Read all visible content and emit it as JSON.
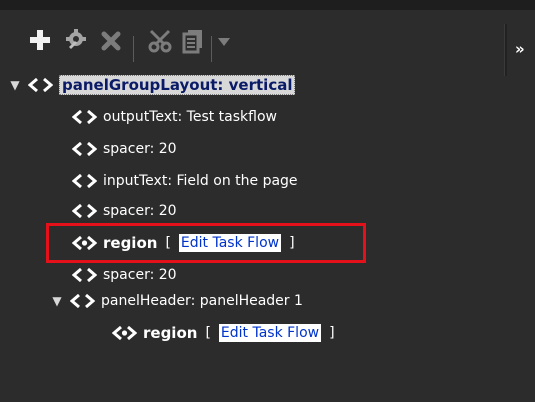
{
  "toolbar": {
    "items": [
      {
        "icon": "plus-icon",
        "color": "#f2f2f2"
      },
      {
        "icon": "gear-icon",
        "color": "#a4a4a4"
      },
      {
        "icon": "delete-icon",
        "color": "#7c7c7c"
      },
      {
        "icon": "cut-icon",
        "color": "#7c7c7c"
      },
      {
        "icon": "copy-icon",
        "color": "#7c7c7c"
      },
      {
        "icon": "dropdown-arrow-icon",
        "color": "#7c7c7c"
      }
    ],
    "overflow_label": "»"
  },
  "tree": {
    "root": {
      "label": "panelGroupLayout: vertical",
      "expanded": true
    },
    "children": [
      {
        "label": "outputText: Test taskflow"
      },
      {
        "label": "spacer: 20"
      },
      {
        "label": "inputText: Field on the page"
      },
      {
        "label": "spacer: 20"
      },
      {
        "label": "region",
        "bracket_open": "[",
        "link_label": "Edit Task Flow",
        "bracket_close": "]",
        "highlighted": true
      },
      {
        "label": "spacer: 20"
      },
      {
        "label": "panelHeader: panelHeader 1",
        "expanded": true,
        "children": [
          {
            "label": "region",
            "bracket_open": "[",
            "link_label": "Edit Task Flow",
            "bracket_close": "]"
          }
        ]
      }
    ]
  },
  "colors": {
    "background": "#2c2c2c",
    "text": "#ffffff",
    "highlight_box": "#e4101a",
    "link_text": "#0033cc"
  }
}
